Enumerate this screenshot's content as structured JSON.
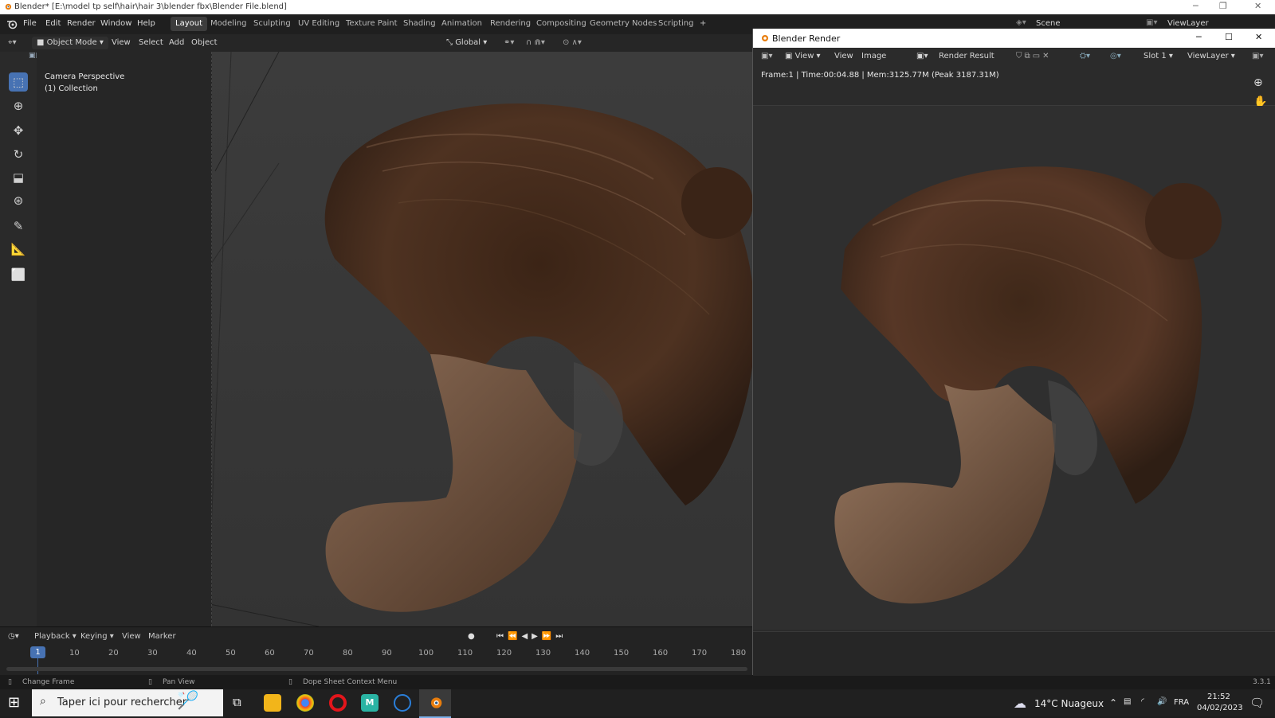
{
  "window": {
    "title": "Blender* [E:\\model tp self\\hair\\hair 3\\blender fbx\\Blender File.blend]",
    "min": "─",
    "restore": "❐",
    "close": "✕"
  },
  "menu": [
    "File",
    "Edit",
    "Render",
    "Window",
    "Help"
  ],
  "workspaces": [
    "Layout",
    "Modeling",
    "Sculpting",
    "UV Editing",
    "Texture Paint",
    "Shading",
    "Animation",
    "Rendering",
    "Compositing",
    "Geometry Nodes",
    "Scripting"
  ],
  "add_workspace": "+",
  "scene": {
    "name": "Scene",
    "view_layer": "ViewLayer"
  },
  "viewport_header": {
    "mode": "Object Mode",
    "view": "View",
    "select": "Select",
    "add": "Add",
    "object": "Object",
    "orientation": "Global"
  },
  "viewport_overlay": {
    "perspective": "Camera Perspective",
    "collection": "(1) Collection"
  },
  "tools": [
    "select-box",
    "cursor",
    "move",
    "rotate",
    "scale",
    "transform",
    "annotate",
    "measure",
    "add-cube"
  ],
  "timeline": {
    "playback": "Playback",
    "keying": "Keying",
    "view": "View",
    "marker": "Marker",
    "current_frame": "1",
    "ticks": [
      "10",
      "20",
      "30",
      "40",
      "50",
      "60",
      "70",
      "80",
      "90",
      "100",
      "110",
      "120",
      "130",
      "140",
      "150",
      "160",
      "170",
      "180"
    ]
  },
  "status": {
    "change_frame": "Change Frame",
    "pan_view": "Pan View",
    "context_menu": "Dope Sheet Context Menu",
    "version": "3.3.1"
  },
  "render_window": {
    "title": "Blender Render",
    "view_menu": "View",
    "view": "View",
    "image": "Image",
    "image_name": "Render Result",
    "slot": "Slot 1",
    "view_layer": "ViewLayer",
    "info": "Frame:1 | Time:00:04.88 | Mem:3125.77M (Peak 3187.31M)"
  },
  "taskbar": {
    "search_placeholder": "Taper ici pour rechercher",
    "weather": "14°C  Nuageux",
    "lang": "FRA",
    "time": "21:52",
    "date": "04/02/2023"
  },
  "colors": {
    "accent": "#4772b3",
    "hair_dark": "#3a2418",
    "hair_mid": "#6b4a34",
    "hair_light": "#a4866e"
  }
}
